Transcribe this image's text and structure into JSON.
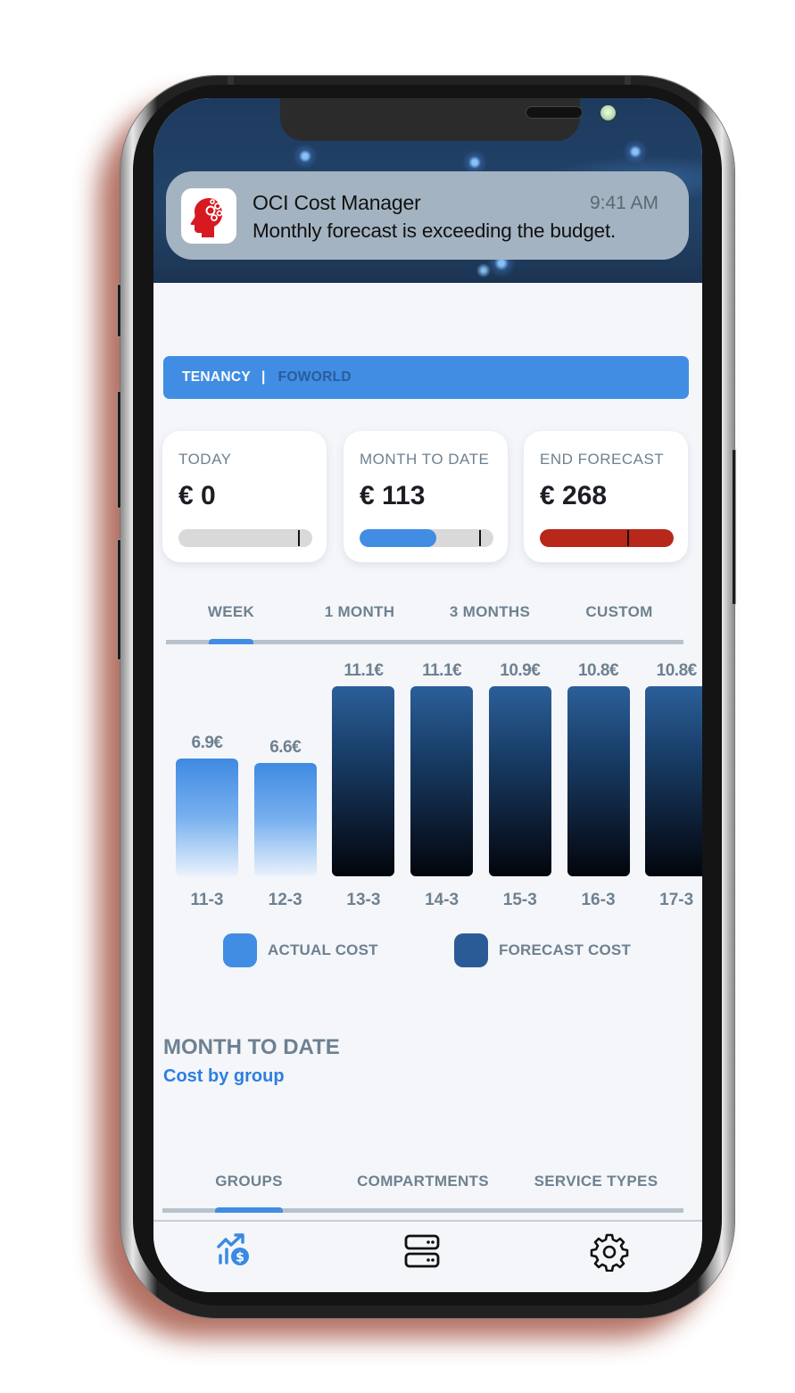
{
  "notification": {
    "app_name": "OCI Cost Manager",
    "time": "9:41 AM",
    "message": "Monthly forecast is exceeding the budget.",
    "icon": "head-gears-icon"
  },
  "tenancy": {
    "label": "TENANCY",
    "separator": "|",
    "value": "FOWORLD"
  },
  "cards": [
    {
      "label": "TODAY",
      "value": "€ 0",
      "progress_fraction": 0.0,
      "budget_marker_fraction": 0.89,
      "fill_color": "#418de3",
      "track_color": "#d9d9d9"
    },
    {
      "label": "MONTH TO DATE",
      "value": "€ 113",
      "progress_fraction": 0.57,
      "budget_marker_fraction": 0.89,
      "fill_color": "#418de3",
      "track_color": "#d9d9d9"
    },
    {
      "label": "END FORECAST",
      "value": "€ 268",
      "progress_fraction": 1.0,
      "budget_marker_fraction": 0.65,
      "fill_color": "#b7271a",
      "track_color": "#d9d9d9"
    }
  ],
  "period_tabs": {
    "items": [
      "WEEK",
      "1 MONTH",
      "3 MONTHS",
      "CUSTOM"
    ],
    "active_index": 0
  },
  "chart_data": {
    "type": "bar",
    "title": "",
    "xlabel": "",
    "ylabel": "",
    "categories": [
      "11-3",
      "12-3",
      "13-3",
      "14-3",
      "15-3",
      "16-3",
      "17-3"
    ],
    "values": [
      6.9,
      6.6,
      11.1,
      11.1,
      10.9,
      10.8,
      10.8
    ],
    "value_labels": [
      "6.9€",
      "6.6€",
      "11.1€",
      "11.1€",
      "10.9€",
      "10.8€",
      "10.8€"
    ],
    "series_type": [
      "actual",
      "actual",
      "forecast",
      "forecast",
      "forecast",
      "forecast",
      "forecast"
    ],
    "series": [
      {
        "name": "ACTUAL COST",
        "color": "#418de3"
      },
      {
        "name": "FORECAST COST",
        "color": "#2a5b97"
      }
    ],
    "legend_position": "bottom",
    "grid": false,
    "ylim": [
      0,
      11.1
    ]
  },
  "section": {
    "title": "MONTH TO DATE",
    "subtitle": "Cost by group"
  },
  "group_tabs": {
    "items": [
      "GROUPS",
      "COMPARTMENTS",
      "SERVICE TYPES"
    ],
    "active_index": 0
  },
  "bottom_nav": [
    {
      "name": "costs-chart-icon",
      "active": true
    },
    {
      "name": "servers-icon",
      "active": false
    },
    {
      "name": "settings-gear-icon",
      "active": false
    }
  ],
  "colors": {
    "accent": "#418de3",
    "danger": "#b7271a",
    "muted_text": "#6e8190"
  }
}
